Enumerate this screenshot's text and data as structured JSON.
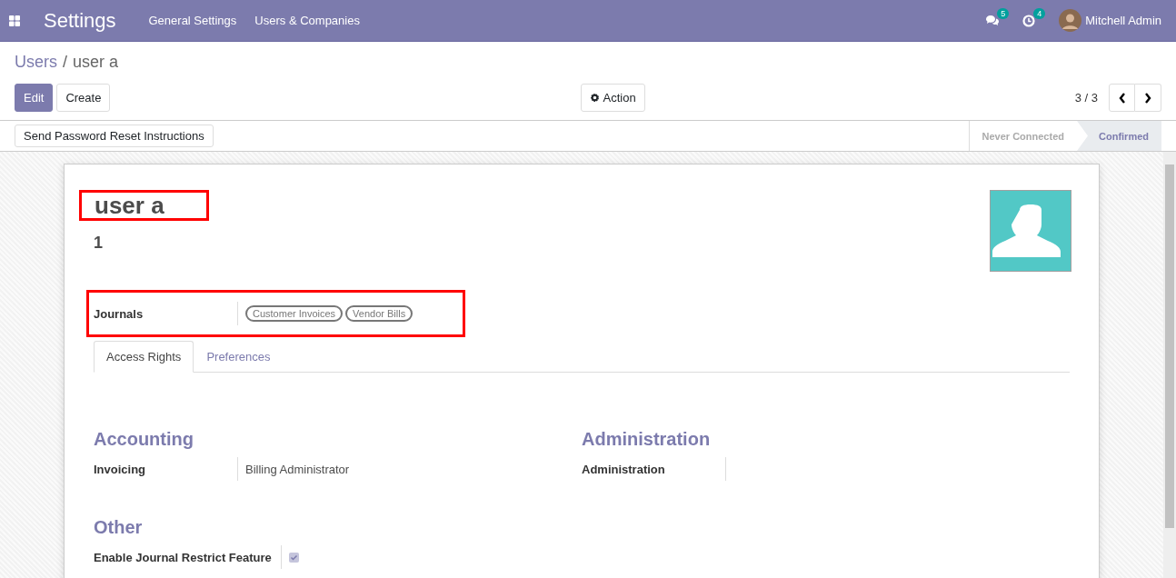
{
  "navbar": {
    "app_name": "Settings",
    "menus": [
      "General Settings",
      "Users & Companies"
    ],
    "messages_count": "5",
    "activities_count": "4",
    "user_name": "Mitchell Admin"
  },
  "breadcrumb": {
    "parent": "Users",
    "separator": "/",
    "current": "user a"
  },
  "buttons": {
    "edit": "Edit",
    "create": "Create",
    "action": "Action"
  },
  "pager": {
    "value": "3 / 3"
  },
  "header_button": "Send Password Reset Instructions",
  "statusbar": [
    {
      "label": "Never Connected",
      "selected": false
    },
    {
      "label": "Confirmed",
      "selected": true
    }
  ],
  "form": {
    "name": "user a",
    "name_highlighted": true,
    "subtitle": "1",
    "journals": {
      "label": "Journals",
      "highlighted": true,
      "tags": [
        "Customer Invoices",
        "Vendor Bills"
      ]
    },
    "tabs": [
      {
        "label": "Access Rights",
        "selected": true
      },
      {
        "label": "Preferences",
        "selected": false
      }
    ],
    "groups": [
      {
        "title": "Accounting",
        "fields": [
          {
            "label": "Invoicing",
            "value": "Billing Administrator"
          }
        ]
      },
      {
        "title": "Administration",
        "fields": [
          {
            "label": "Administration"
          }
        ]
      }
    ],
    "other": {
      "title": "Other",
      "fields": [
        {
          "label": "Enable Journal Restrict Feature",
          "kind": "checkbox",
          "checked": true
        }
      ]
    }
  }
}
